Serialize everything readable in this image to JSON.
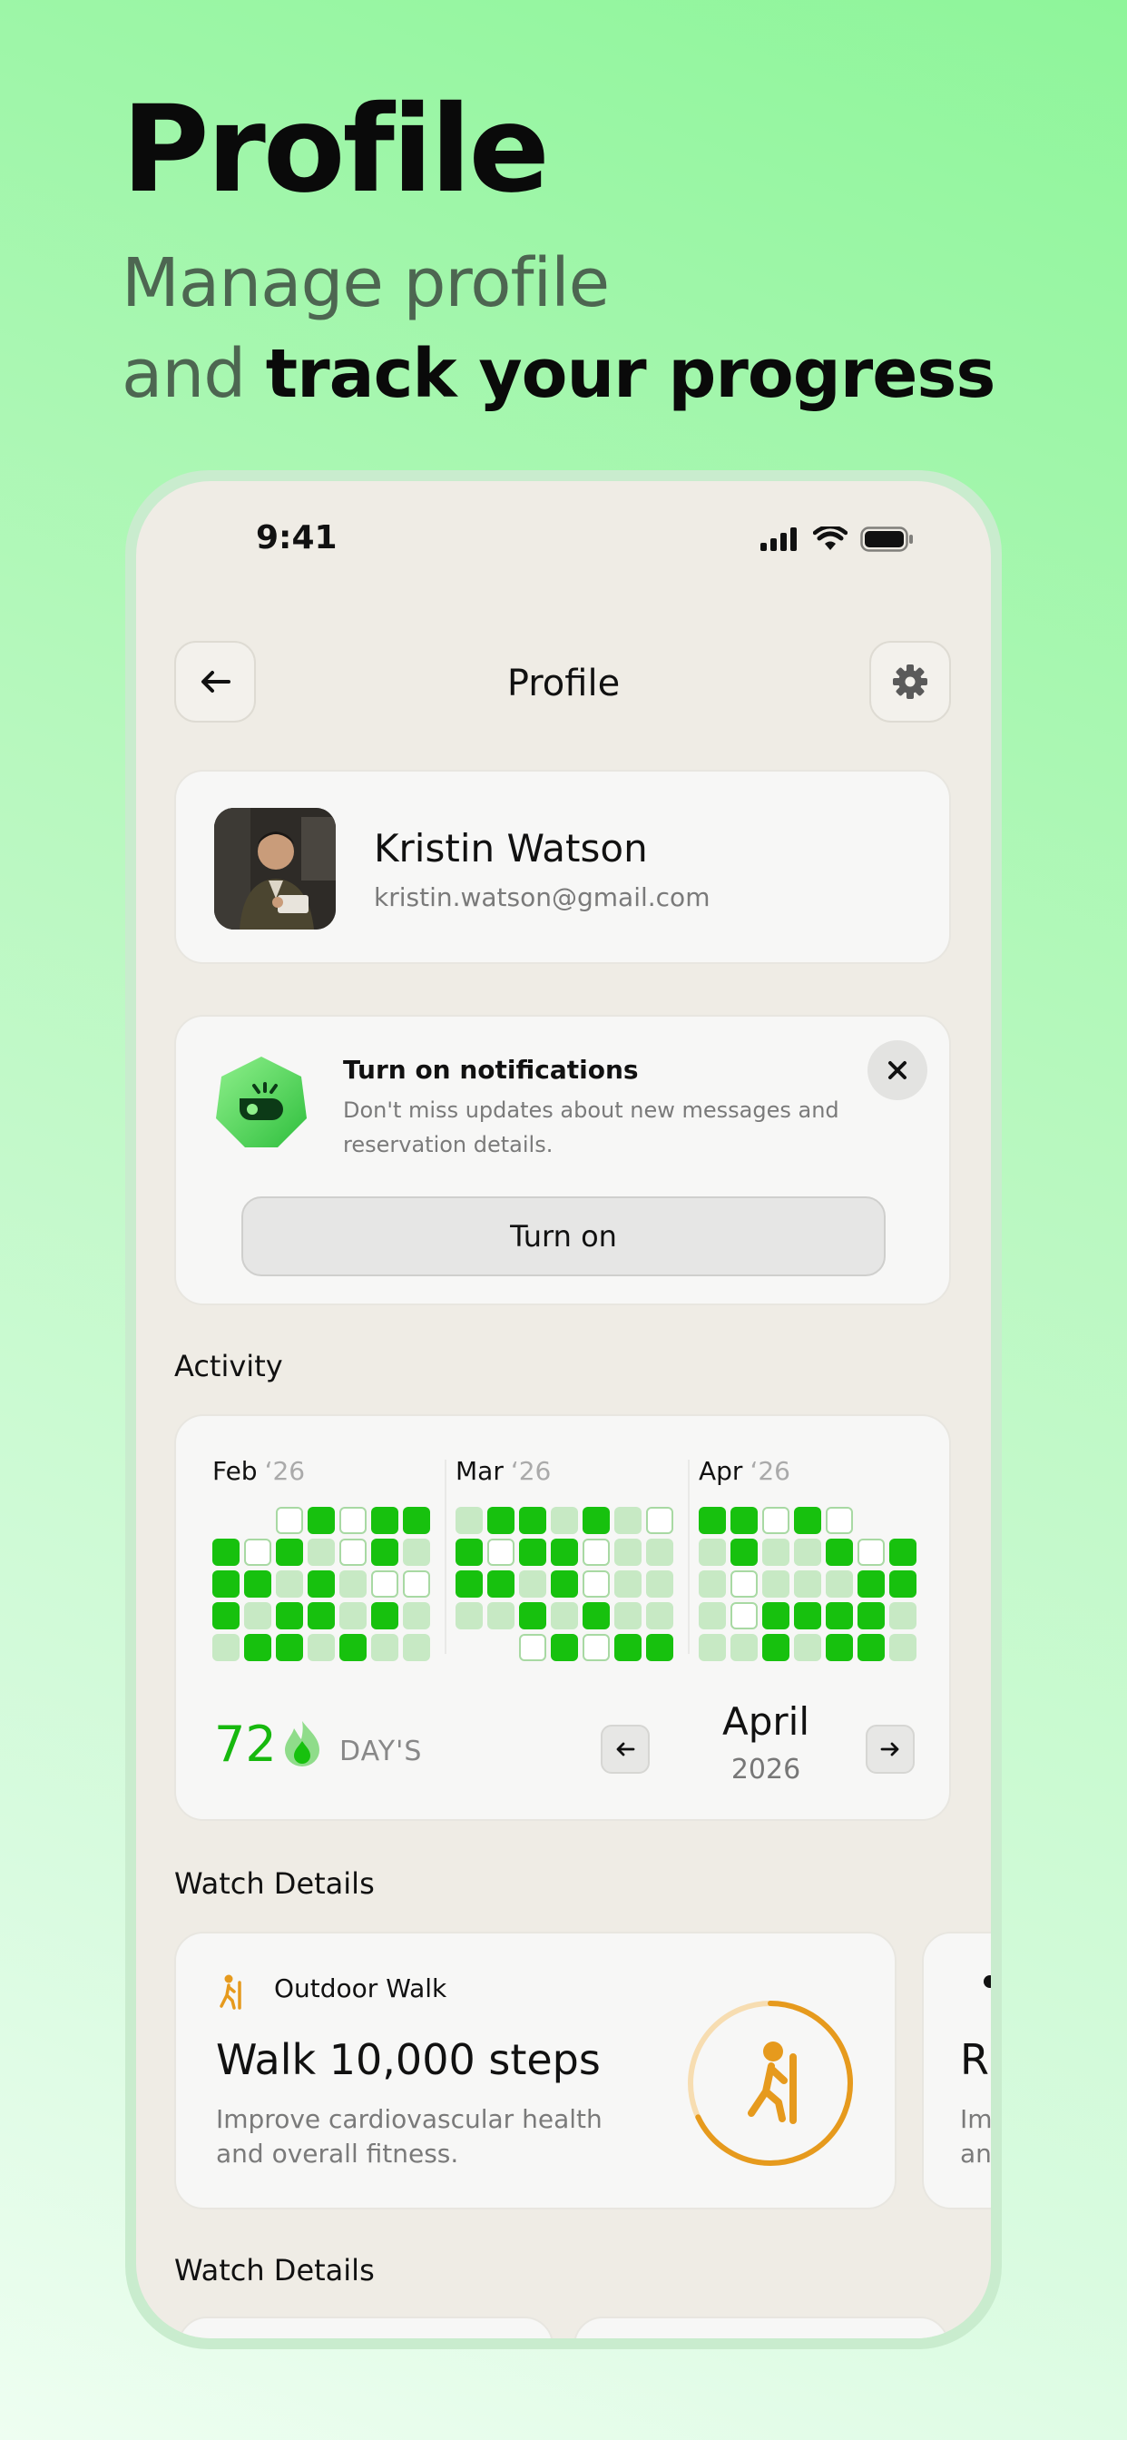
{
  "hero": {
    "title": "Profile",
    "subtitle_line1": "Manage profile",
    "subtitle_line2_plain": "and",
    "subtitle_line2_bold": "track your progress"
  },
  "status_bar": {
    "time": "9:41"
  },
  "nav": {
    "title": "Profile"
  },
  "profile": {
    "name": "Kristin Watson",
    "email": "kristin.watson@gmail.com"
  },
  "notification": {
    "title": "Turn on notifications",
    "description": "Don't miss updates about new messages and reservation details.",
    "button_label": "Turn on"
  },
  "activity": {
    "section_title": "Activity",
    "months": [
      {
        "name": "Feb",
        "year": "‘26",
        "rows": [
          [
            0,
            0,
            3,
            1,
            3,
            1,
            1
          ],
          [
            1,
            3,
            1,
            2,
            3,
            1,
            2
          ],
          [
            1,
            1,
            2,
            1,
            2,
            3,
            3
          ],
          [
            1,
            2,
            1,
            1,
            2,
            1,
            2
          ],
          [
            2,
            1,
            1,
            2,
            1,
            2,
            2
          ]
        ]
      },
      {
        "name": "Mar",
        "year": "‘26",
        "rows": [
          [
            2,
            1,
            1,
            2,
            1,
            2,
            3
          ],
          [
            1,
            3,
            1,
            1,
            3,
            2,
            2
          ],
          [
            1,
            1,
            2,
            1,
            3,
            2,
            2
          ],
          [
            2,
            2,
            1,
            2,
            1,
            2,
            2
          ],
          [
            0,
            0,
            3,
            1,
            3,
            1,
            1
          ]
        ]
      },
      {
        "name": "Apr",
        "year": "‘26",
        "rows": [
          [
            1,
            1,
            3,
            1,
            3,
            0,
            0
          ],
          [
            2,
            1,
            2,
            2,
            1,
            3,
            1
          ],
          [
            2,
            3,
            2,
            2,
            2,
            1,
            1
          ],
          [
            2,
            3,
            1,
            1,
            1,
            1,
            2
          ],
          [
            2,
            2,
            1,
            2,
            1,
            1,
            2
          ]
        ]
      }
    ],
    "streak_value": "72",
    "streak_label": "DAY'S",
    "selected_month": "April",
    "selected_year": "2026"
  },
  "watch_details": {
    "section_title": "Watch Details",
    "card": {
      "tag": "Outdoor Walk",
      "title": "Walk 10,000 steps",
      "description": "Improve cardiovascular health and overall fitness.",
      "progress": 0.68
    },
    "peek_card": {
      "title_fragment": "R",
      "description_fragment": "Im an"
    }
  },
  "watch_details_2": {
    "section_title": "Watch Details"
  },
  "colors": {
    "accent_green": "#17c10e",
    "walk_orange": "#e69a1d",
    "background": "#efece5"
  }
}
